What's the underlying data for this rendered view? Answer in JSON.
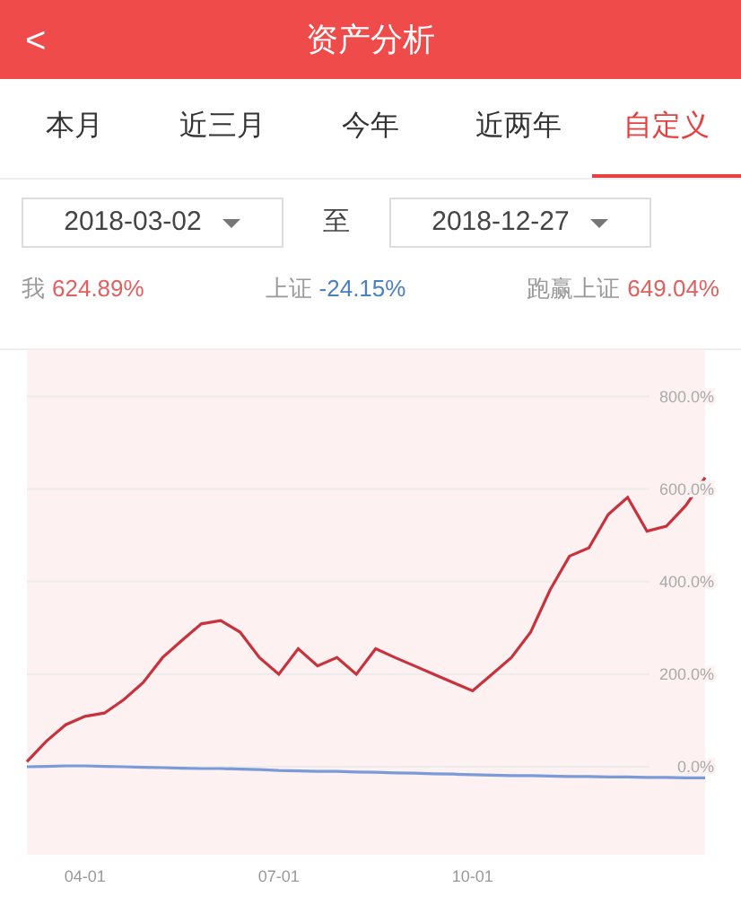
{
  "header": {
    "back": "<",
    "title": "资产分析"
  },
  "tabs": [
    {
      "label": "本月",
      "selected": false
    },
    {
      "label": "近三月",
      "selected": false
    },
    {
      "label": "今年",
      "selected": false
    },
    {
      "label": "近两年",
      "selected": false
    },
    {
      "label": "自定义",
      "selected": true
    }
  ],
  "date_range": {
    "start": "2018-03-02",
    "separator": "至",
    "end": "2018-12-27"
  },
  "stats": [
    {
      "label": "我",
      "value": "624.89%",
      "color": "#e06060"
    },
    {
      "label": "上证",
      "value": "-24.15%",
      "color": "#4a7fc0"
    },
    {
      "label": "跑赢上证",
      "value": "649.04%",
      "color": "#e06060"
    }
  ],
  "chart": {
    "chart_data": {
      "type": "line",
      "categories": [
        null,
        null,
        null,
        "04-01",
        null,
        null,
        null,
        null,
        null,
        null,
        null,
        null,
        null,
        "07-01",
        null,
        null,
        null,
        null,
        null,
        null,
        null,
        null,
        null,
        "10-01",
        null,
        null,
        null,
        null,
        null,
        null,
        null,
        null,
        null,
        null,
        null,
        null
      ],
      "series": [
        {
          "color": "#c8323c",
          "values": [
            11,
            55,
            91,
            109,
            116,
            145,
            182,
            236,
            273,
            309,
            316,
            291,
            236,
            200,
            255,
            218,
            236,
            200,
            255,
            236,
            218,
            200,
            182,
            164,
            200,
            236,
            291,
            382,
            455,
            473,
            545,
            582,
            509,
            520,
            564,
            625
          ]
        },
        {
          "color": "#7a9ad8",
          "values": [
            0,
            1,
            2,
            2,
            1,
            0,
            -1,
            -2,
            -3,
            -4,
            -4,
            -5,
            -6,
            -8,
            -9,
            -10,
            -10,
            -11,
            -12,
            -13,
            -14,
            -15,
            -16,
            -17,
            -18,
            -19,
            -19,
            -20,
            -21,
            -21,
            -22,
            -22,
            -23,
            -23,
            -24,
            -24
          ]
        }
      ],
      "ylim": [
        -190,
        900
      ],
      "grid": true,
      "yticks": [
        {
          "value": 0,
          "label": "0.0%"
        },
        {
          "value": 200,
          "label": "200.0%"
        },
        {
          "value": 400,
          "label": "400.0%"
        },
        {
          "value": 600,
          "label": "600.0%"
        },
        {
          "value": 800,
          "label": "800.0%"
        }
      ]
    }
  }
}
